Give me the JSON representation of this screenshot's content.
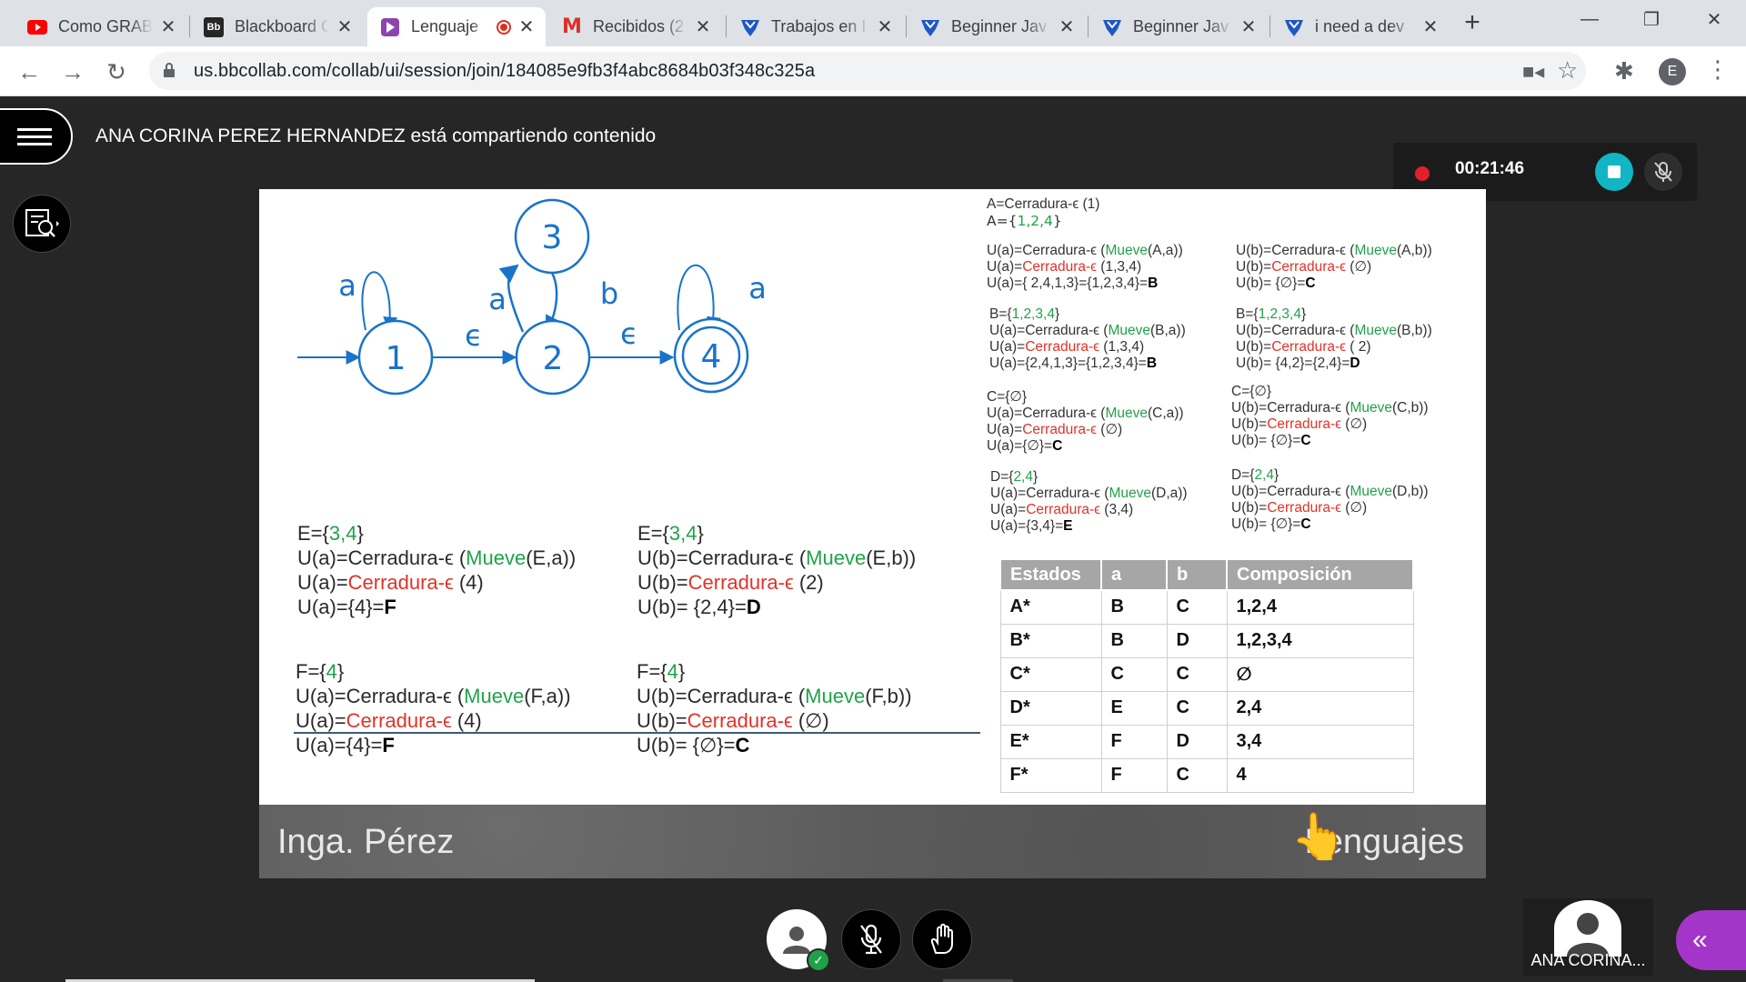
{
  "browser": {
    "tabs": [
      {
        "label": "Como GRAB",
        "icon": "youtube-icon",
        "color": "#ff0000"
      },
      {
        "label": "Blackboard C",
        "icon": "blackboard-icon",
        "color": "#262626"
      },
      {
        "label": "Lenguaje",
        "icon": "collaborate-icon",
        "color": "#8e44ad",
        "recording": true
      },
      {
        "label": "Recibidos (2",
        "icon": "gmail-icon",
        "color": "#d93025"
      },
      {
        "label": "Trabajos en I",
        "icon": "upwork-icon",
        "color": "#1f57c3"
      },
      {
        "label": "Beginner Jav",
        "icon": "upwork-icon",
        "color": "#1f57c3"
      },
      {
        "label": "Beginner Jav",
        "icon": "upwork-icon",
        "color": "#1f57c3"
      },
      {
        "label": "i need a dev",
        "icon": "upwork-icon",
        "color": "#1f57c3"
      }
    ],
    "url": "us.bbcollab.com/collab/ui/session/join/184085e9fb3f4abc8684b03f348c325a",
    "profile_initial": "E"
  },
  "session": {
    "sharing_text": "ANA CORINA PEREZ HERNANDEZ está compartiendo contenido",
    "recording_time": "00:21:46",
    "participant_name": "ANA CORINA...",
    "accent": "#a336c9",
    "record_color": "#e0202a",
    "stop_color": "#11b5c4"
  },
  "slide": {
    "automaton": {
      "states": [
        "1",
        "2",
        "3",
        "4"
      ],
      "labels": {
        "loop1": "a",
        "e12": "ϵ",
        "e23": "a",
        "e32": "b",
        "e24": "ϵ",
        "loop4": "a"
      },
      "final_state": "4"
    },
    "right_blocks": {
      "A": [
        "A=Cerradura-ϵ (1)",
        "A={1,2,4}"
      ],
      "Aa": [
        "U(a)=Cerradura-ϵ (Mueve(A,a))",
        "U(a)=Cerradura-ϵ (1,3,4)",
        "U(a)={ 2,4,1,3}={1,2,3,4}=B"
      ],
      "Ab": [
        "U(b)=Cerradura-ϵ (Mueve(A,b))",
        "U(b)=Cerradura-ϵ (∅)",
        "U(b)= {∅}=C"
      ],
      "Ba": [
        "B={1,2,3,4}",
        "U(a)=Cerradura-ϵ (Mueve(B,a))",
        "U(a)=Cerradura-ϵ (1,3,4)",
        "U(a)={2,4,1,3}={1,2,3,4}=B"
      ],
      "Bb": [
        "B={1,2,3,4}",
        "U(b)=Cerradura-ϵ (Mueve(B,b))",
        "U(b)=Cerradura-ϵ ( 2)",
        "U(b)= {4,2}={2,4}=D"
      ],
      "Ca": [
        "C={∅}",
        "U(a)=Cerradura-ϵ (Mueve(C,a))",
        "U(a)=Cerradura-ϵ (∅)",
        "U(a)={∅}=C"
      ],
      "Cb": [
        "C={∅}",
        "U(b)=Cerradura-ϵ (Mueve(C,b))",
        "U(b)=Cerradura-ϵ (∅)",
        "U(b)= {∅}=C"
      ],
      "Da": [
        "D={2,4}",
        "U(a)=Cerradura-ϵ (Mueve(D,a))",
        "U(a)=Cerradura-ϵ (3,4)",
        "U(a)={3,4}=E"
      ],
      "Db": [
        "D={2,4}",
        "U(b)=Cerradura-ϵ (Mueve(D,b))",
        "U(b)=Cerradura-ϵ (∅)",
        "U(b)= {∅}=C"
      ]
    },
    "left_blocks": {
      "Ea": [
        "E={3,4}",
        "U(a)=Cerradura-ϵ (Mueve(E,a))",
        "U(a)=Cerradura-ϵ (4)",
        "U(a)={4}=F"
      ],
      "Eb": [
        "E={3,4}",
        "U(b)=Cerradura-ϵ (Mueve(E,b))",
        "U(b)=Cerradura-ϵ (2)",
        "U(b)= {2,4}=D"
      ],
      "Fa": [
        "F={4}",
        "U(a)=Cerradura-ϵ (Mueve(F,a))",
        "U(a)=Cerradura-ϵ (4)",
        "U(a)={4}=F"
      ],
      "Fb": [
        "F={4}",
        "U(b)=Cerradura-ϵ (Mueve(F,b))",
        "U(b)=Cerradura-ϵ (∅)",
        "U(b)= {∅}=C"
      ]
    },
    "table": {
      "headers": [
        "Estados",
        "a",
        "b",
        "Composición"
      ],
      "rows": [
        [
          "A*",
          "B",
          "C",
          "1,2,4"
        ],
        [
          "B*",
          "B",
          "D",
          "1,2,3,4"
        ],
        [
          "C*",
          "C",
          "C",
          "∅"
        ],
        [
          "D*",
          "E",
          "C",
          "2,4"
        ],
        [
          "E*",
          "F",
          "D",
          "3,4"
        ],
        [
          "F*",
          "F",
          "C",
          "4"
        ]
      ]
    },
    "footer_author": "Inga. Pérez",
    "footer_course": "Lenguajes",
    "colors": {
      "green": "#21a24a",
      "red": "#e23228",
      "diagram_blue": "#1a73c9"
    }
  }
}
